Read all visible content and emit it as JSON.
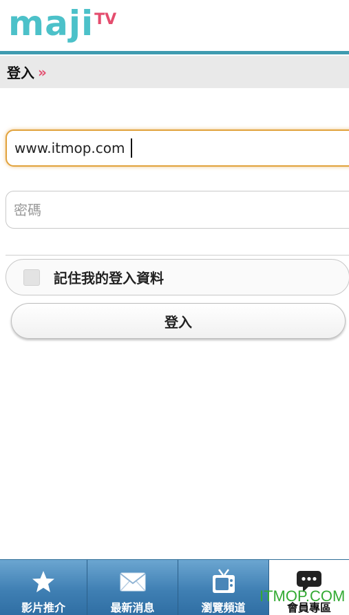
{
  "header": {
    "logo_main": "maji",
    "logo_tv": "TV"
  },
  "breadcrumb": {
    "title": "登入",
    "separator": "»"
  },
  "form": {
    "username_value": "www.itmop.com",
    "password_placeholder": "密碼",
    "remember_label": "記住我的登入資料",
    "remember_checked": false,
    "login_button": "登入"
  },
  "tabs": [
    {
      "label": "影片推介",
      "icon": "star-icon",
      "active": false
    },
    {
      "label": "最新消息",
      "icon": "envelope-icon",
      "active": false
    },
    {
      "label": "瀏覽頻道",
      "icon": "tv-icon",
      "active": false
    },
    {
      "label": "會員專區",
      "icon": "chat-bubble-icon",
      "active": true
    }
  ],
  "watermark": "ITMOP.COM",
  "colors": {
    "logo_teal": "#4cc1c9",
    "logo_pink": "#e44d6e",
    "header_rule": "#3f9bb0",
    "tab_blue": "#3f7fb3",
    "focus_orange": "#e1a23b"
  }
}
